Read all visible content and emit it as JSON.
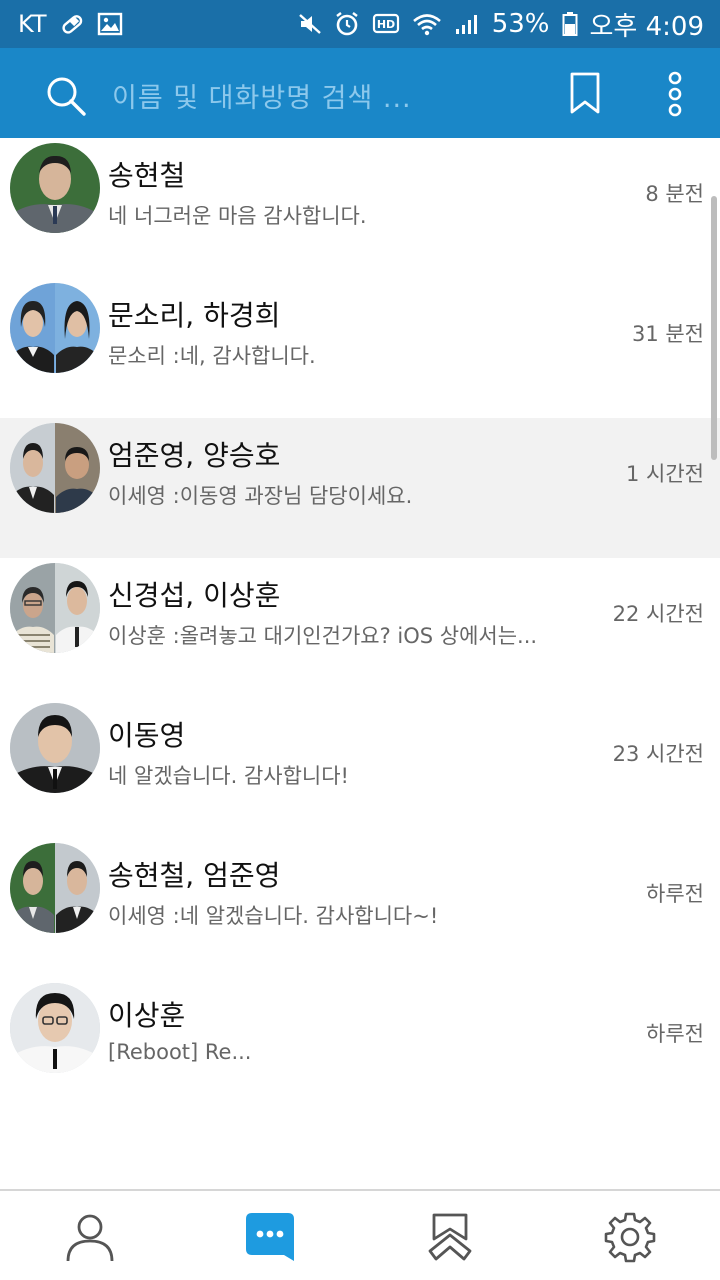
{
  "status_bar": {
    "carrier": "KT",
    "battery": "53%",
    "time": "오후 4:09",
    "icons": [
      "pill-icon",
      "image-icon",
      "mute-icon",
      "alarm-icon",
      "hd-icon",
      "wifi-icon",
      "signal-icon",
      "battery-icon"
    ]
  },
  "header": {
    "search_placeholder": "이름 및 대화방명 검색 ...",
    "icons": [
      "search-icon",
      "bookmark-icon",
      "more-vert-icon"
    ],
    "background": "#1a87c8"
  },
  "chats": [
    {
      "name": "송현철",
      "preview": "네 너그러운 마음 감사합니다.",
      "time": "8 분전"
    },
    {
      "name": "문소리, 하경희",
      "preview": "문소리 :네, 감사합니다.",
      "time": "31 분전"
    },
    {
      "name": "엄준영, 양승호",
      "preview": "이세영 :이동영 과장님 담당이세요.",
      "time": "1 시간전"
    },
    {
      "name": "신경섭, 이상훈",
      "preview": "이상훈 :올려놓고 대기인건가요? iOS 상에서는...",
      "time": "22 시간전"
    },
    {
      "name": "이동영",
      "preview": "네 알겠습니다. 감사합니다!",
      "time": "23 시간전"
    },
    {
      "name": "송현철, 엄준영",
      "preview": "이세영 :네 알겠습니다. 감사합니다~!",
      "time": "하루전"
    },
    {
      "name": "이상훈",
      "preview": "[Reboot] Re...",
      "time": "하루전"
    }
  ],
  "bottom_nav": {
    "items": [
      "person-icon",
      "chat-bubble-icon",
      "bookmarks-icon",
      "gear-icon"
    ],
    "active_color": "#1e9be0"
  }
}
